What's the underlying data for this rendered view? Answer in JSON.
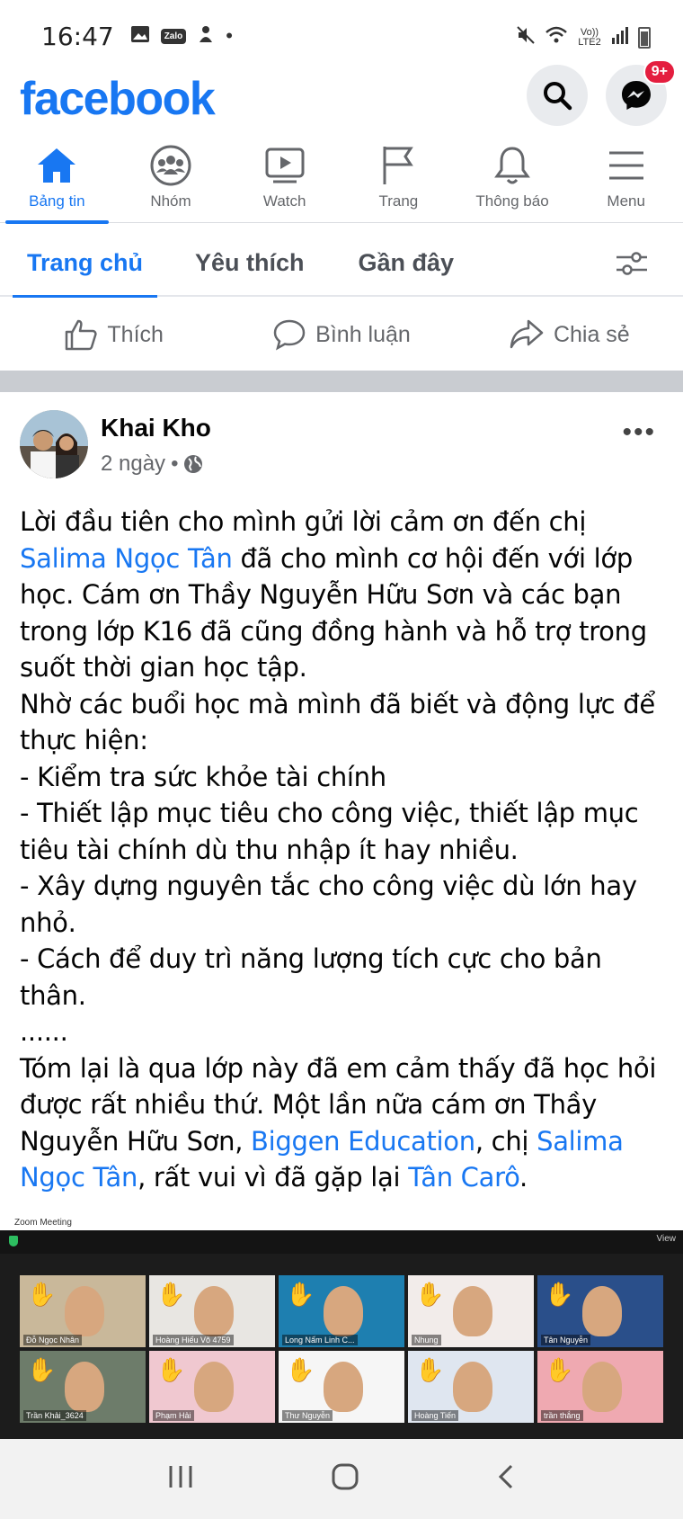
{
  "status_bar": {
    "time": "16:47",
    "zalo": "Zalo",
    "network": "Vo)) LTE2",
    "icons": [
      "image-icon",
      "zalo-icon",
      "notification-icon",
      "dot-icon",
      "mute-icon",
      "wifi-icon",
      "signal-icon",
      "battery-icon"
    ]
  },
  "header": {
    "logo": "facebook",
    "messenger_badge": "9+"
  },
  "nav": {
    "items": [
      {
        "label": "Bảng tin",
        "icon": "home-icon",
        "active": true
      },
      {
        "label": "Nhóm",
        "icon": "groups-icon"
      },
      {
        "label": "Watch",
        "icon": "watch-icon"
      },
      {
        "label": "Trang",
        "icon": "flag-icon"
      },
      {
        "label": "Thông báo",
        "icon": "bell-icon"
      },
      {
        "label": "Menu",
        "icon": "menu-icon"
      }
    ]
  },
  "subtabs": {
    "items": [
      {
        "label": "Trang chủ",
        "active": true
      },
      {
        "label": "Yêu thích"
      },
      {
        "label": "Gần đây"
      }
    ]
  },
  "actions": {
    "like": "Thích",
    "comment": "Bình luận",
    "share": "Chia sẻ"
  },
  "post": {
    "author": "Khai Kho",
    "time": "2 ngày",
    "separator": "•",
    "text": {
      "l1": "Lời đầu tiên cho mình gửi lời cảm ơn đến chị",
      "mention1": "Salima Ngọc Tân",
      "l2": " đã cho mình cơ hội đến với lớp học. Cám ơn Thầy Nguyễn Hữu Sơn và các bạn trong lớp K16 đã cũng đồng hành và hỗ trợ trong suốt thời gian học tập.",
      "l3": "Nhờ các buổi học mà mình đã biết và động lực để thực hiện:",
      "b1": "- Kiểm tra sức khỏe tài chính",
      "b2": "- Thiết lập mục tiêu cho công việc, thiết lập mục tiêu tài chính dù thu nhập ít hay nhiều.",
      "b3": "- Xây dựng nguyên tắc cho công việc dù lớn hay nhỏ.",
      "b4": "- Cách để duy trì năng lượng tích cực cho bản thân.",
      "ellipsis": "......",
      "l4": "Tóm lại là qua lớp này đã em cảm thấy đã học hỏi được rất nhiều thứ. Một lần nữa cám ơn Thầy Nguyễn Hữu Sơn, ",
      "mention2": "Biggen Education",
      "l5": ", chị ",
      "mention3": "Salima Ngọc Tân",
      "l6": ", rất vui vì đã gặp lại ",
      "mention4": "Tân Carô",
      "l7": "."
    }
  },
  "zoom": {
    "title": "Zoom Meeting",
    "view": "View",
    "participants": [
      "Đỗ Ngọc Nhân",
      "Hoàng Hiếu Võ 4759",
      "Long Nấm Linh C...",
      "Nhung",
      "Tân Nguyễn",
      "Trần Khải_3624",
      "Phạm Hải",
      "Thư Nguyễn",
      "Hoàng Tiến",
      "trần thắng"
    ],
    "colors": [
      "#c9b89a",
      "#e8e6e2",
      "#1e7fb0",
      "#f2ecea",
      "#2a4f8a",
      "#6d7c6a",
      "#f0c8d0",
      "#f6f6f6",
      "#dfe6f0",
      "#efa9b1"
    ]
  }
}
